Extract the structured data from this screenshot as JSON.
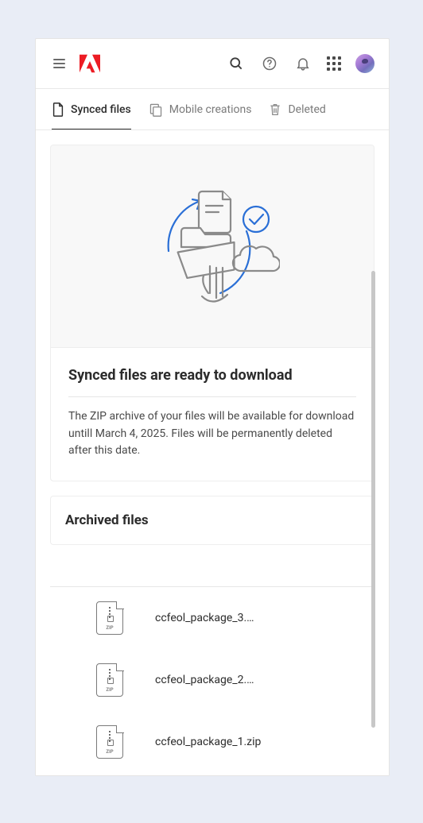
{
  "tabs": {
    "synced": "Synced files",
    "mobile": "Mobile creations",
    "deleted": "Deleted"
  },
  "card": {
    "title": "Synced files are ready to download",
    "text": "The ZIP archive of your files will be available for download untill March 4, 2025. Files will be permanently deleted after this date."
  },
  "archived": {
    "header": "Archived files",
    "files": [
      {
        "name": "ccfeol_package_3.…",
        "ext": "ZIP"
      },
      {
        "name": "ccfeol_package_2.…",
        "ext": "ZIP"
      },
      {
        "name": "ccfeol_package_1.zip",
        "ext": "ZIP"
      }
    ]
  }
}
